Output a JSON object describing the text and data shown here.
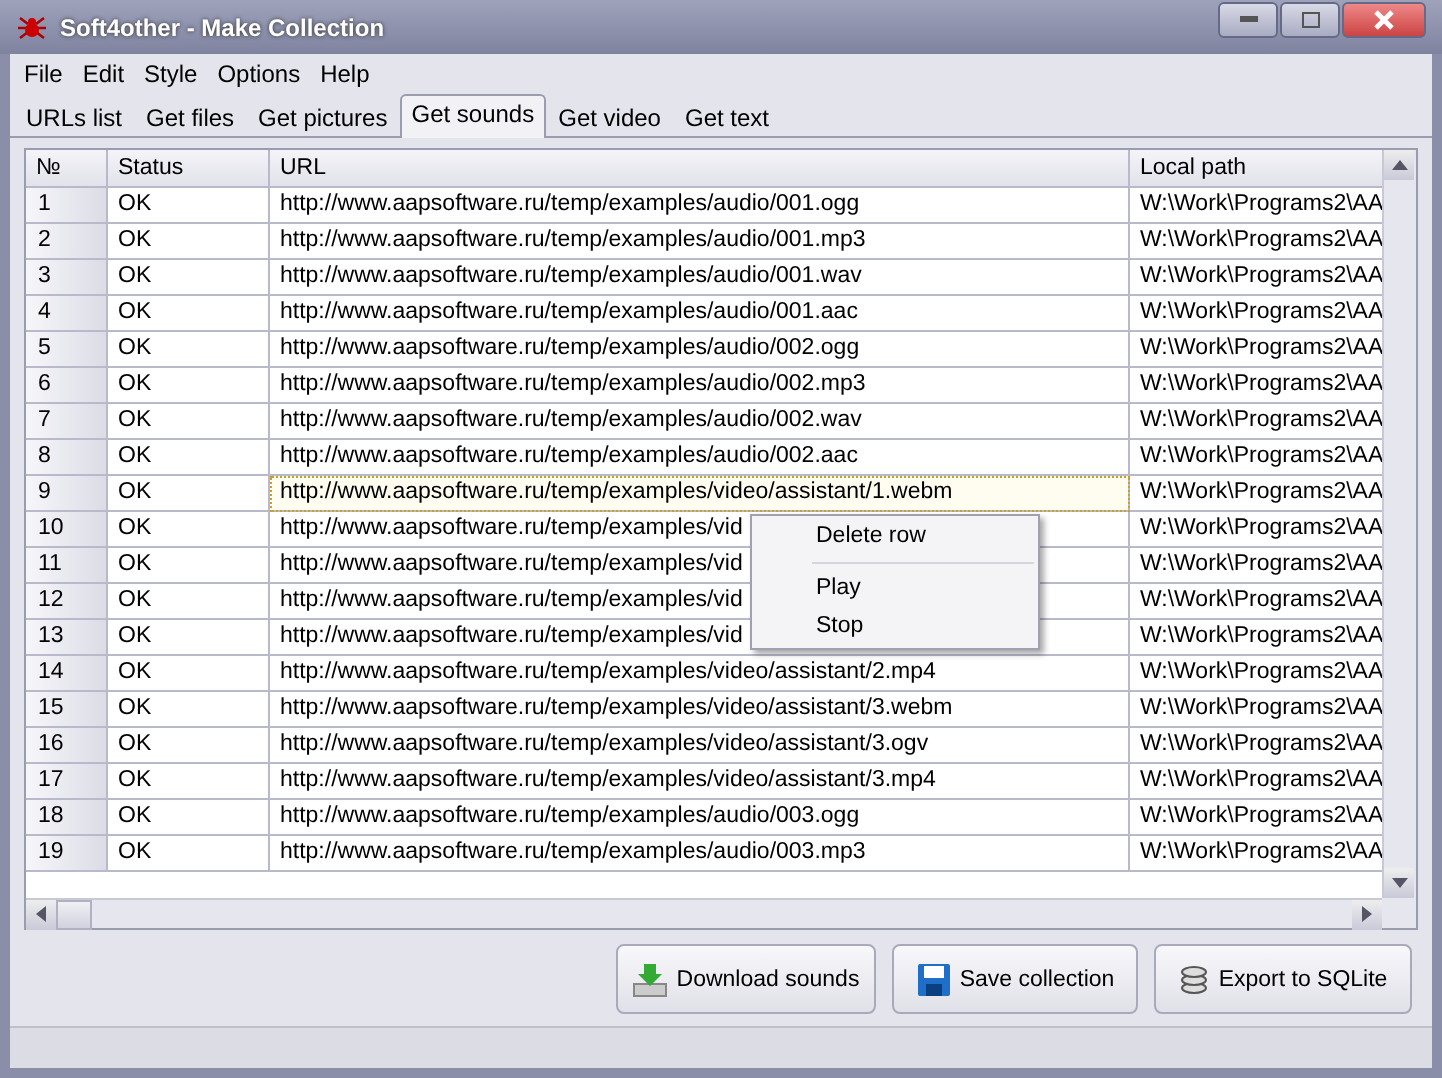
{
  "window": {
    "title": "Soft4other - Make Collection"
  },
  "menu": [
    "File",
    "Edit",
    "Style",
    "Options",
    "Help"
  ],
  "tabs": [
    {
      "label": "URLs list",
      "selected": false
    },
    {
      "label": "Get files",
      "selected": false
    },
    {
      "label": "Get pictures",
      "selected": false
    },
    {
      "label": "Get sounds",
      "selected": true
    },
    {
      "label": "Get video",
      "selected": false
    },
    {
      "label": "Get text",
      "selected": false
    }
  ],
  "table": {
    "columns": [
      "№",
      "Status",
      "URL",
      "Local path"
    ],
    "rows": [
      {
        "n": "1",
        "status": "OK",
        "url": "http://www.aapsoftware.ru/temp/examples/audio/001.ogg",
        "path": "W:\\Work\\Programs2\\AA",
        "selected": false
      },
      {
        "n": "2",
        "status": "OK",
        "url": "http://www.aapsoftware.ru/temp/examples/audio/001.mp3",
        "path": "W:\\Work\\Programs2\\AA",
        "selected": false
      },
      {
        "n": "3",
        "status": "OK",
        "url": "http://www.aapsoftware.ru/temp/examples/audio/001.wav",
        "path": "W:\\Work\\Programs2\\AA",
        "selected": false
      },
      {
        "n": "4",
        "status": "OK",
        "url": "http://www.aapsoftware.ru/temp/examples/audio/001.aac",
        "path": "W:\\Work\\Programs2\\AA",
        "selected": false
      },
      {
        "n": "5",
        "status": "OK",
        "url": "http://www.aapsoftware.ru/temp/examples/audio/002.ogg",
        "path": "W:\\Work\\Programs2\\AA",
        "selected": false
      },
      {
        "n": "6",
        "status": "OK",
        "url": "http://www.aapsoftware.ru/temp/examples/audio/002.mp3",
        "path": "W:\\Work\\Programs2\\AA",
        "selected": false
      },
      {
        "n": "7",
        "status": "OK",
        "url": "http://www.aapsoftware.ru/temp/examples/audio/002.wav",
        "path": "W:\\Work\\Programs2\\AA",
        "selected": false
      },
      {
        "n": "8",
        "status": "OK",
        "url": "http://www.aapsoftware.ru/temp/examples/audio/002.aac",
        "path": "W:\\Work\\Programs2\\AA",
        "selected": false
      },
      {
        "n": "9",
        "status": "OK",
        "url": "http://www.aapsoftware.ru/temp/examples/video/assistant/1.webm",
        "path": "W:\\Work\\Programs2\\AA",
        "selected": true
      },
      {
        "n": "10",
        "status": "OK",
        "url": "http://www.aapsoftware.ru/temp/examples/vid",
        "path": "W:\\Work\\Programs2\\AA",
        "selected": false
      },
      {
        "n": "11",
        "status": "OK",
        "url": "http://www.aapsoftware.ru/temp/examples/vid",
        "path": "W:\\Work\\Programs2\\AA",
        "selected": false
      },
      {
        "n": "12",
        "status": "OK",
        "url": "http://www.aapsoftware.ru/temp/examples/vid",
        "path": "W:\\Work\\Programs2\\AA",
        "selected": false
      },
      {
        "n": "13",
        "status": "OK",
        "url": "http://www.aapsoftware.ru/temp/examples/vid",
        "path": "W:\\Work\\Programs2\\AA",
        "selected": false
      },
      {
        "n": "14",
        "status": "OK",
        "url": "http://www.aapsoftware.ru/temp/examples/video/assistant/2.mp4",
        "path": "W:\\Work\\Programs2\\AA",
        "selected": false
      },
      {
        "n": "15",
        "status": "OK",
        "url": "http://www.aapsoftware.ru/temp/examples/video/assistant/3.webm",
        "path": "W:\\Work\\Programs2\\AA",
        "selected": false
      },
      {
        "n": "16",
        "status": "OK",
        "url": "http://www.aapsoftware.ru/temp/examples/video/assistant/3.ogv",
        "path": "W:\\Work\\Programs2\\AA",
        "selected": false
      },
      {
        "n": "17",
        "status": "OK",
        "url": "http://www.aapsoftware.ru/temp/examples/video/assistant/3.mp4",
        "path": "W:\\Work\\Programs2\\AA",
        "selected": false
      },
      {
        "n": "18",
        "status": "OK",
        "url": "http://www.aapsoftware.ru/temp/examples/audio/003.ogg",
        "path": "W:\\Work\\Programs2\\AA",
        "selected": false
      },
      {
        "n": "19",
        "status": "OK",
        "url": "http://www.aapsoftware.ru/temp/examples/audio/003.mp3",
        "path": "W:\\Work\\Programs2\\AA",
        "selected": false
      }
    ]
  },
  "context_menu": [
    {
      "label": "Delete row",
      "kind": "item"
    },
    {
      "kind": "separator"
    },
    {
      "label": "Play",
      "kind": "item"
    },
    {
      "label": "Stop",
      "kind": "item"
    }
  ],
  "buttons": [
    {
      "label": "Download sounds",
      "kind": "download"
    },
    {
      "label": "Save collection",
      "kind": "save"
    },
    {
      "label": "Export to SQLite",
      "kind": "database"
    }
  ]
}
